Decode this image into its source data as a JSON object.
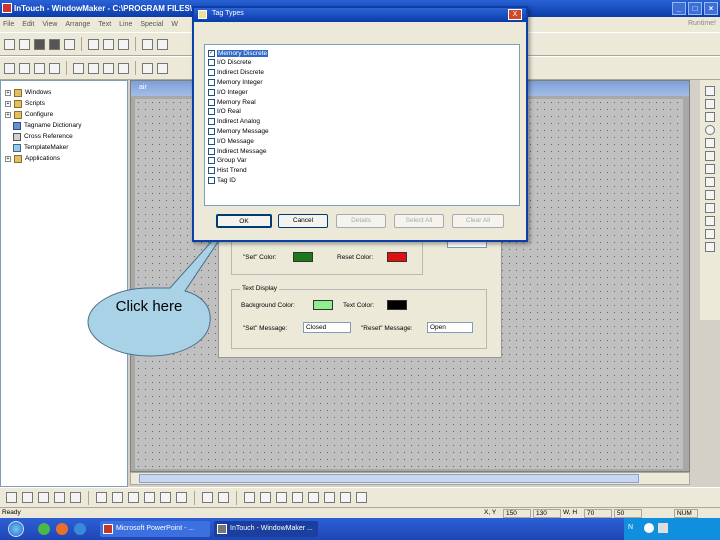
{
  "app": {
    "title": "InTouch - WindowMaker - C:\\PROGRAM FILES\\"
  },
  "menu": {
    "items": [
      "File",
      "Edit",
      "View",
      "Arrange",
      "Text",
      "Line",
      "Special",
      "W"
    ],
    "right_label": "Runtime!"
  },
  "tree": {
    "items": [
      {
        "label": "Windows",
        "expander": "+"
      },
      {
        "label": "Scripts",
        "expander": "+"
      },
      {
        "label": "Configure",
        "expander": "+"
      },
      {
        "label": "Tagname Dictionary",
        "expander": ""
      },
      {
        "label": "Cross Reference",
        "expander": ""
      },
      {
        "label": "TemplateMaker",
        "expander": ""
      },
      {
        "label": "Applications",
        "expander": "+"
      }
    ]
  },
  "canvas": {
    "title": "air"
  },
  "tag_dialog": {
    "title": "Tag Types",
    "close_symbol": "X",
    "items": [
      {
        "label": "Memory Discrete",
        "checked": true
      },
      {
        "label": "I/O Discrete",
        "checked": false
      },
      {
        "label": "Indirect Discrete",
        "checked": false
      },
      {
        "label": "Memory Integer",
        "checked": false
      },
      {
        "label": "I/O Integer",
        "checked": false
      },
      {
        "label": "Memory Real",
        "checked": false
      },
      {
        "label": "I/O Real",
        "checked": false
      },
      {
        "label": "Indirect Analog",
        "checked": false
      },
      {
        "label": "Memory Message",
        "checked": false
      },
      {
        "label": "I/O Message",
        "checked": false
      },
      {
        "label": "Indirect Message",
        "checked": false
      },
      {
        "label": "Group Var",
        "checked": false
      },
      {
        "label": "Hist Trend",
        "checked": false
      },
      {
        "label": "Tag ID",
        "checked": false
      }
    ],
    "buttons": {
      "ok": "OK",
      "cancel": "Cancel",
      "details": "Details",
      "select_all": "Select All",
      "clear_all": "Clear All"
    }
  },
  "config_dialog": {
    "set_color_label": "\"Set\" Color:",
    "reset_color_label": "Reset Color:",
    "set_color": "#1a7a1a",
    "reset_color": "#e01010",
    "text_display_title": "Text Display",
    "background_color_label": "Background Color:",
    "text_color_label": "Text Color:",
    "background_color": "#90ee90",
    "text_color": "#000000",
    "set_message_label": "\"Set\" Message:",
    "set_message_value": "Closed",
    "reset_message_label": "\"Reset\" Message:",
    "reset_message_value": "Open"
  },
  "callout": {
    "text": "Click here"
  },
  "status": {
    "ready": "Ready",
    "xy_label": "X, Y",
    "x": "150",
    "y": "130",
    "wh_label": "W, H",
    "w": "70",
    "h": "50",
    "num": "NUM"
  },
  "taskbar": {
    "tasks": [
      {
        "label": "Microsoft PowerPoint - ...",
        "color": "#c0392b"
      },
      {
        "label": "InTouch - WindowMaker ...",
        "color": "#777777"
      }
    ],
    "tray_label": "N"
  },
  "colors": {
    "title_bar": "#0a3ca8",
    "selection": "#316ac5",
    "callout_fill": "#a9d2e6"
  }
}
